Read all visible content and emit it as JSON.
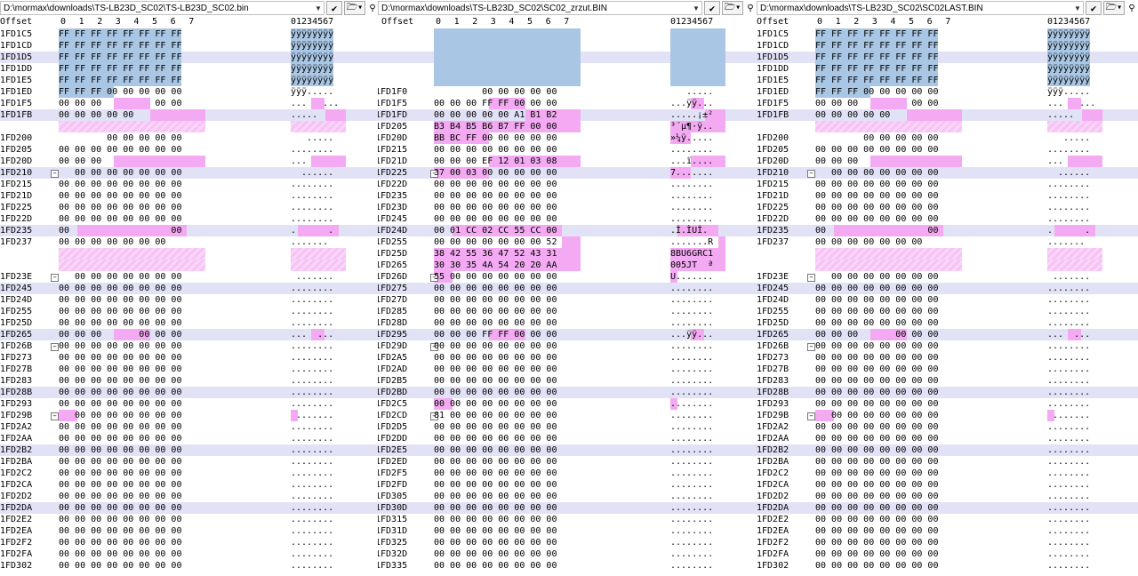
{
  "panes": [
    {
      "path": "D:\\mormax\\downloads\\TS-LB23D_SC02\\TS-LB23D_SC02.bin",
      "header": {
        "offset": "Offset",
        "cols": [
          "0",
          "1",
          "2",
          "3",
          "4",
          "5",
          "6",
          "7"
        ],
        "ascii": "01234567"
      },
      "rows": [
        {
          "off": "1FD1C5",
          "hex": "FF FF FF FF FF FF FF FF",
          "asc": "ÿÿÿÿÿÿÿÿ",
          "hl": "blue"
        },
        {
          "off": "1FD1CD",
          "hex": "FF FF FF FF FF FF FF FF",
          "asc": "ÿÿÿÿÿÿÿÿ",
          "hl": "blue"
        },
        {
          "off": "1FD1D5",
          "hex": "FF FF FF FF FF FF FF FF",
          "asc": "ÿÿÿÿÿÿÿÿ",
          "hl": "blue",
          "band": true
        },
        {
          "off": "1FD1DD",
          "hex": "FF FF FF FF FF FF FF FF",
          "asc": "ÿÿÿÿÿÿÿÿ",
          "hl": "blue"
        },
        {
          "off": "1FD1E5",
          "hex": "FF FF FF FF FF FF FF FF",
          "asc": "ÿÿÿÿÿÿÿÿ",
          "hl": "blue"
        },
        {
          "off": "1FD1ED",
          "hex": "FF FF FF 00 00 00 00 00",
          "asc": "ÿÿÿ.....",
          "hl": "blue3"
        },
        {
          "off": "1FD1F5",
          "hex": "00 00 00          00 00",
          "asc": "...   ..."
        },
        {
          "off": "1FD1FB",
          "hex": "00 00 00 00 00         ",
          "asc": ".....   ",
          "band": true
        },
        {
          "off": "",
          "hex": "",
          "asc": "",
          "gap": true
        },
        {
          "off": "1FD200",
          "hex": "         00 00 00 00 00",
          "asc": "   ....."
        },
        {
          "off": "1FD205",
          "hex": "00 00 00 00 00 00 00 00",
          "asc": "........"
        },
        {
          "off": "1FD20D",
          "hex": "00 00 00               ",
          "asc": "...     "
        },
        {
          "off": "1FD210",
          "hex": "   00 00 00 00 00 00 00",
          "asc": "  ......",
          "fold": true,
          "band": true
        },
        {
          "off": "1FD215",
          "hex": "00 00 00 00 00 00 00 00",
          "asc": "........"
        },
        {
          "off": "1FD21D",
          "hex": "00 00 00 00 00 00 00 00",
          "asc": "........"
        },
        {
          "off": "1FD225",
          "hex": "00 00 00 00 00 00 00 00",
          "asc": "........"
        },
        {
          "off": "1FD22D",
          "hex": "00 00 00 00 00 00 00 00",
          "asc": "........"
        },
        {
          "off": "1FD235",
          "hex": "00                   00",
          "asc": ".      .",
          "band": true
        },
        {
          "off": "1FD237",
          "hex": "00 00 00 00 00 00 00   ",
          "asc": "....... "
        },
        {
          "off": "",
          "hex": "",
          "asc": "",
          "gap": true
        },
        {
          "off": "",
          "hex": "",
          "asc": "",
          "gap": true
        },
        {
          "off": "1FD23E",
          "hex": "   00 00 00 00 00 00 00",
          "asc": " .......",
          "fold": true
        },
        {
          "off": "1FD245",
          "hex": "00 00 00 00 00 00 00 00",
          "asc": "........",
          "band": true
        },
        {
          "off": "1FD24D",
          "hex": "00 00 00 00 00 00 00 00",
          "asc": "........"
        },
        {
          "off": "1FD255",
          "hex": "00 00 00 00 00 00 00 00",
          "asc": "........"
        },
        {
          "off": "1FD25D",
          "hex": "00 00 00 00 00 00 00 00",
          "asc": "........"
        },
        {
          "off": "1FD265",
          "hex": "00 00 00       00 00 00",
          "asc": "...  ...",
          "band": true
        },
        {
          "off": "1FD26B",
          "hex": "00 00 00 00 00 00 00 00",
          "asc": "........",
          "fold": true
        },
        {
          "off": "1FD273",
          "hex": "00 00 00 00 00 00 00 00",
          "asc": "........"
        },
        {
          "off": "1FD27B",
          "hex": "00 00 00 00 00 00 00 00",
          "asc": "........"
        },
        {
          "off": "1FD283",
          "hex": "00 00 00 00 00 00 00 00",
          "asc": "........"
        },
        {
          "off": "1FD28B",
          "hex": "00 00 00 00 00 00 00 00",
          "asc": "........",
          "band": true
        },
        {
          "off": "1FD293",
          "hex": "00 00 00 00 00 00 00 00",
          "asc": "........"
        },
        {
          "off": "1FD29B",
          "hex": "   00 00 00 00 00 00 00",
          "asc": " .......",
          "fold": true
        },
        {
          "off": "1FD2A2",
          "hex": "00 00 00 00 00 00 00 00",
          "asc": "........"
        },
        {
          "off": "1FD2AA",
          "hex": "00 00 00 00 00 00 00 00",
          "asc": "........"
        },
        {
          "off": "1FD2B2",
          "hex": "00 00 00 00 00 00 00 00",
          "asc": "........",
          "band": true
        },
        {
          "off": "1FD2BA",
          "hex": "00 00 00 00 00 00 00 00",
          "asc": "........"
        },
        {
          "off": "1FD2C2",
          "hex": "00 00 00 00 00 00 00 00",
          "asc": "........"
        },
        {
          "off": "1FD2CA",
          "hex": "00 00 00 00 00 00 00 00",
          "asc": "........"
        },
        {
          "off": "1FD2D2",
          "hex": "00 00 00 00 00 00 00 00",
          "asc": "........"
        },
        {
          "off": "1FD2DA",
          "hex": "00 00 00 00 00 00 00 00",
          "asc": "........",
          "band": true
        },
        {
          "off": "1FD2E2",
          "hex": "00 00 00 00 00 00 00 00",
          "asc": "........"
        },
        {
          "off": "1FD2EA",
          "hex": "00 00 00 00 00 00 00 00",
          "asc": "........"
        },
        {
          "off": "1FD2F2",
          "hex": "00 00 00 00 00 00 00 00",
          "asc": "........"
        },
        {
          "off": "1FD2FA",
          "hex": "00 00 00 00 00 00 00 00",
          "asc": "........"
        },
        {
          "off": "1FD302",
          "hex": "00 00 00 00 00 00 00 00",
          "asc": "........"
        }
      ]
    },
    {
      "path": "D:\\mormax\\downloads\\TS-LB23D_SC02\\SC02_zrzut.BIN",
      "header": {
        "offset": "Offset",
        "cols": [
          "0",
          "1",
          "2",
          "3",
          "4",
          "5",
          "6",
          "7"
        ],
        "ascii": "01234567"
      },
      "rows": [
        {
          "off": "",
          "hex": "",
          "asc": "",
          "gap": true
        },
        {
          "off": "",
          "hex": "",
          "asc": "",
          "gap": true
        },
        {
          "off": "",
          "hex": "",
          "asc": "",
          "gap": true,
          "band": true
        },
        {
          "off": "",
          "hex": "",
          "asc": "",
          "gap": true
        },
        {
          "off": "",
          "hex": "",
          "asc": "",
          "gap": true
        },
        {
          "off": "1FD1F0",
          "hex": "         00 00 00 00 00",
          "asc": "   .....  "
        },
        {
          "off": "1FD1F5",
          "hex": "00 00 00 FF FF 00 00 00",
          "asc": "...ÿÿ..."
        },
        {
          "off": "1FD1FD",
          "hex": "00 00 00 00 00 A1 B1 B2",
          "asc": ".....¡±²",
          "band": true
        },
        {
          "off": "1FD205",
          "hex": "B3 B4 B5 B6 B7 FF 00 00",
          "asc": "³´µ¶·ÿ.."
        },
        {
          "off": "1FD20D",
          "hex": "BB BC FF 00 00 00 00 00",
          "asc": "»¼ÿ....."
        },
        {
          "off": "1FD215",
          "hex": "00 00 00 00 00 00 00 00",
          "asc": "........"
        },
        {
          "off": "1FD21D",
          "hex": "00 00 00 EF 12 01 03 08",
          "asc": "...ï...."
        },
        {
          "off": "1FD225",
          "hex": "37 00 03 00 00 00 00 00",
          "asc": "7.......",
          "fold": true,
          "band": true
        },
        {
          "off": "1FD22D",
          "hex": "00 00 00 00 00 00 00 00",
          "asc": "........"
        },
        {
          "off": "1FD235",
          "hex": "00 00 00 00 00 00 00 00",
          "asc": "........"
        },
        {
          "off": "1FD23D",
          "hex": "00 00 00 00 00 00 00 00",
          "asc": "........"
        },
        {
          "off": "1FD245",
          "hex": "00 00 00 00 00 00 00 00",
          "asc": "........"
        },
        {
          "off": "1FD24D",
          "hex": "00 01 CC 02 CC 55 CC 00",
          "asc": ".Ì.ÌUÌ.",
          "band": true
        },
        {
          "off": "1FD255",
          "hex": "00 00 00 00 00 00 00 52",
          "asc": ".......R"
        },
        {
          "off": "1FD25D",
          "hex": "38 42 55 36 47 52 43 31",
          "asc": "8BU6GRC1"
        },
        {
          "off": "1FD265",
          "hex": "30 30 35 4A 54 20 20 AA",
          "asc": "005JT  ª"
        },
        {
          "off": "1FD26D",
          "hex": "55 00 00 00 00 00 00 00",
          "asc": "U.......",
          "fold": true
        },
        {
          "off": "1FD275",
          "hex": "00 00 00 00 00 00 00 00",
          "asc": "........",
          "band": true
        },
        {
          "off": "1FD27D",
          "hex": "00 00 00 00 00 00 00 00",
          "asc": "........"
        },
        {
          "off": "1FD285",
          "hex": "00 00 00 00 00 00 00 00",
          "asc": "........"
        },
        {
          "off": "1FD28D",
          "hex": "00 00 00 00 00 00 00 00",
          "asc": "........"
        },
        {
          "off": "1FD295",
          "hex": "00 00 00 FF FF 00 00 00",
          "asc": "...ÿÿ...",
          "band": true
        },
        {
          "off": "1FD29D",
          "hex": "00 00 00 00 00 00 00 00",
          "asc": "........",
          "fold": true
        },
        {
          "off": "1FD2A5",
          "hex": "00 00 00 00 00 00 00 00",
          "asc": "........"
        },
        {
          "off": "1FD2AD",
          "hex": "00 00 00 00 00 00 00 00",
          "asc": "........"
        },
        {
          "off": "1FD2B5",
          "hex": "00 00 00 00 00 00 00 00",
          "asc": "........"
        },
        {
          "off": "1FD2BD",
          "hex": "00 00 00 00 00 00 00 00",
          "asc": "........",
          "band": true
        },
        {
          "off": "1FD2C5",
          "hex": "00 00 00 00 00 00 00 00",
          "asc": "........"
        },
        {
          "off": "1FD2CD",
          "hex": "81 00 00 00 00 00 00 00",
          "asc": "........",
          "fold": true
        },
        {
          "off": "1FD2D5",
          "hex": "00 00 00 00 00 00 00 00",
          "asc": "........"
        },
        {
          "off": "1FD2DD",
          "hex": "00 00 00 00 00 00 00 00",
          "asc": "........"
        },
        {
          "off": "1FD2E5",
          "hex": "00 00 00 00 00 00 00 00",
          "asc": "........",
          "band": true
        },
        {
          "off": "1FD2ED",
          "hex": "00 00 00 00 00 00 00 00",
          "asc": "........"
        },
        {
          "off": "1FD2F5",
          "hex": "00 00 00 00 00 00 00 00",
          "asc": "........"
        },
        {
          "off": "1FD2FD",
          "hex": "00 00 00 00 00 00 00 00",
          "asc": "........"
        },
        {
          "off": "1FD305",
          "hex": "00 00 00 00 00 00 00 00",
          "asc": "........"
        },
        {
          "off": "1FD30D",
          "hex": "00 00 00 00 00 00 00 00",
          "asc": "........",
          "band": true
        },
        {
          "off": "1FD315",
          "hex": "00 00 00 00 00 00 00 00",
          "asc": "........"
        },
        {
          "off": "1FD31D",
          "hex": "00 00 00 00 00 00 00 00",
          "asc": "........"
        },
        {
          "off": "1FD325",
          "hex": "00 00 00 00 00 00 00 00",
          "asc": "........"
        },
        {
          "off": "1FD32D",
          "hex": "00 00 00 00 00 00 00 00",
          "asc": "........"
        },
        {
          "off": "1FD335",
          "hex": "00 00 00 00 00 00 00 00",
          "asc": "........"
        }
      ]
    },
    {
      "path": "D:\\mormax\\downloads\\TS-LB23D_SC02\\SC02LAST.BIN",
      "header": {
        "offset": "Offset",
        "cols": [
          "0",
          "1",
          "2",
          "3",
          "4",
          "5",
          "6",
          "7"
        ],
        "ascii": "01234567"
      },
      "rows": [
        {
          "off": "1FD1C5",
          "hex": "FF FF FF FF FF FF FF FF",
          "asc": "ÿÿÿÿÿÿÿÿ",
          "hl": "blue"
        },
        {
          "off": "1FD1CD",
          "hex": "FF FF FF FF FF FF FF FF",
          "asc": "ÿÿÿÿÿÿÿÿ",
          "hl": "blue"
        },
        {
          "off": "1FD1D5",
          "hex": "FF FF FF FF FF FF FF FF",
          "asc": "ÿÿÿÿÿÿÿÿ",
          "hl": "blue",
          "band": true
        },
        {
          "off": "1FD1DD",
          "hex": "FF FF FF FF FF FF FF FF",
          "asc": "ÿÿÿÿÿÿÿÿ",
          "hl": "blue"
        },
        {
          "off": "1FD1E5",
          "hex": "FF FF FF FF FF FF FF FF",
          "asc": "ÿÿÿÿÿÿÿÿ",
          "hl": "blue"
        },
        {
          "off": "1FD1ED",
          "hex": "FF FF FF 00 00 00 00 00",
          "asc": "ÿÿÿ.....",
          "hl": "blue3"
        },
        {
          "off": "1FD1F5",
          "hex": "00 00 00          00 00",
          "asc": "...   ..."
        },
        {
          "off": "1FD1FB",
          "hex": "00 00 00 00 00         ",
          "asc": ".....   ",
          "band": true
        },
        {
          "off": "",
          "hex": "",
          "asc": "",
          "gap": true
        },
        {
          "off": "1FD200",
          "hex": "         00 00 00 00 00",
          "asc": "   ....."
        },
        {
          "off": "1FD205",
          "hex": "00 00 00 00 00 00 00 00",
          "asc": "........"
        },
        {
          "off": "1FD20D",
          "hex": "00 00 00               ",
          "asc": "...     "
        },
        {
          "off": "1FD210",
          "hex": "   00 00 00 00 00 00 00",
          "asc": "  ......",
          "fold": true,
          "band": true
        },
        {
          "off": "1FD215",
          "hex": "00 00 00 00 00 00 00 00",
          "asc": "........"
        },
        {
          "off": "1FD21D",
          "hex": "00 00 00 00 00 00 00 00",
          "asc": "........"
        },
        {
          "off": "1FD225",
          "hex": "00 00 00 00 00 00 00 00",
          "asc": "........"
        },
        {
          "off": "1FD22D",
          "hex": "00 00 00 00 00 00 00 00",
          "asc": "........"
        },
        {
          "off": "1FD235",
          "hex": "00                   00",
          "asc": ".      .",
          "band": true
        },
        {
          "off": "1FD237",
          "hex": "00 00 00 00 00 00 00   ",
          "asc": "....... "
        },
        {
          "off": "",
          "hex": "",
          "asc": "",
          "gap": true
        },
        {
          "off": "",
          "hex": "",
          "asc": "",
          "gap": true
        },
        {
          "off": "1FD23E",
          "hex": "   00 00 00 00 00 00 00",
          "asc": " .......",
          "fold": true
        },
        {
          "off": "1FD245",
          "hex": "00 00 00 00 00 00 00 00",
          "asc": "........",
          "band": true
        },
        {
          "off": "1FD24D",
          "hex": "00 00 00 00 00 00 00 00",
          "asc": "........"
        },
        {
          "off": "1FD255",
          "hex": "00 00 00 00 00 00 00 00",
          "asc": "........"
        },
        {
          "off": "1FD25D",
          "hex": "00 00 00 00 00 00 00 00",
          "asc": "........"
        },
        {
          "off": "1FD265",
          "hex": "00 00 00       00 00 00",
          "asc": "...  ...",
          "band": true
        },
        {
          "off": "1FD26B",
          "hex": "00 00 00 00 00 00 00 00",
          "asc": "........",
          "fold": true
        },
        {
          "off": "1FD273",
          "hex": "00 00 00 00 00 00 00 00",
          "asc": "........"
        },
        {
          "off": "1FD27B",
          "hex": "00 00 00 00 00 00 00 00",
          "asc": "........"
        },
        {
          "off": "1FD283",
          "hex": "00 00 00 00 00 00 00 00",
          "asc": "........"
        },
        {
          "off": "1FD28B",
          "hex": "00 00 00 00 00 00 00 00",
          "asc": "........",
          "band": true
        },
        {
          "off": "1FD293",
          "hex": "00 00 00 00 00 00 00 00",
          "asc": "........"
        },
        {
          "off": "1FD29B",
          "hex": "   00 00 00 00 00 00 00",
          "asc": " .......",
          "fold": true
        },
        {
          "off": "1FD2A2",
          "hex": "00 00 00 00 00 00 00 00",
          "asc": "........"
        },
        {
          "off": "1FD2AA",
          "hex": "00 00 00 00 00 00 00 00",
          "asc": "........"
        },
        {
          "off": "1FD2B2",
          "hex": "00 00 00 00 00 00 00 00",
          "asc": "........",
          "band": true
        },
        {
          "off": "1FD2BA",
          "hex": "00 00 00 00 00 00 00 00",
          "asc": "........"
        },
        {
          "off": "1FD2C2",
          "hex": "00 00 00 00 00 00 00 00",
          "asc": "........"
        },
        {
          "off": "1FD2CA",
          "hex": "00 00 00 00 00 00 00 00",
          "asc": "........"
        },
        {
          "off": "1FD2D2",
          "hex": "00 00 00 00 00 00 00 00",
          "asc": "........"
        },
        {
          "off": "1FD2DA",
          "hex": "00 00 00 00 00 00 00 00",
          "asc": "........",
          "band": true
        },
        {
          "off": "1FD2E2",
          "hex": "00 00 00 00 00 00 00 00",
          "asc": "........"
        },
        {
          "off": "1FD2EA",
          "hex": "00 00 00 00 00 00 00 00",
          "asc": "........"
        },
        {
          "off": "1FD2F2",
          "hex": "00 00 00 00 00 00 00 00",
          "asc": "........"
        },
        {
          "off": "1FD2FA",
          "hex": "00 00 00 00 00 00 00 00",
          "asc": "........"
        },
        {
          "off": "1FD302",
          "hex": "00 00 00 00 00 00 00 00",
          "asc": "........"
        }
      ]
    }
  ],
  "colors": {
    "band": "#e2e2f7",
    "blue": "#a9c6e4",
    "pink": "#f4aaf2"
  },
  "icons": {
    "dropdown": "chevron-down-icon",
    "check": "check-icon",
    "folder": "open-folder-icon",
    "binoculars": "binoculars-icon",
    "close": "close-icon"
  }
}
